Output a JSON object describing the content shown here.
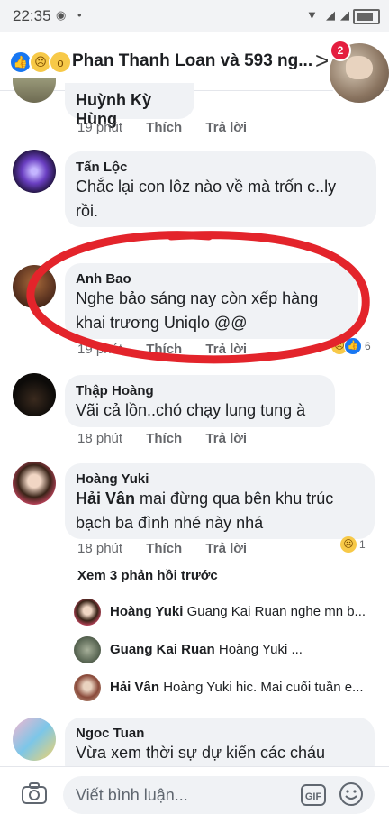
{
  "status_bar": {
    "time": "22:35"
  },
  "header": {
    "title": "Phan Thanh Loan và 593 ng...",
    "chathead_badge": "2"
  },
  "comments": [
    {
      "author": "Huỳnh Kỳ Hùng",
      "text": "",
      "time": "19 phút",
      "like": "Thích",
      "reply": "Trả lời"
    },
    {
      "author": "Tấn Lộc",
      "text1": "Chắc lại con lôz nào về mà trốn c..ly",
      "text2": "rồi."
    },
    {
      "author": "Anh Bao",
      "text1": "Nghe bảo sáng nay còn xếp hàng",
      "text2": "khai trương Uniqlo @@",
      "time": "19 phút",
      "like": "Thích",
      "reply": "Trả lời",
      "reactions": "6"
    },
    {
      "author": "Thập Hoàng",
      "text1": "Vãi cả lồn..chó chạy lung tung à",
      "time": "18 phút",
      "like": "Thích",
      "reply": "Trả lời"
    },
    {
      "author": "Hoàng Yuki",
      "mention": "Hải Vân",
      "text1": " mai đừng qua bên khu trúc",
      "text2": "bạch ba đình nhé này nhá",
      "time": "18 phút",
      "like": "Thích",
      "reply": "Trả lời",
      "reactions": "1"
    },
    {
      "author": "Ngoc Tuan",
      "text1": "Vừa xem thời sự dự kiến các cháu"
    }
  ],
  "replies_link": "Xem 3 phản hồi trước",
  "replies": [
    {
      "name": "Hoàng Yuki",
      "text": "Guang Kai Ruan  nghe mn b..."
    },
    {
      "name": "Guang Kai Ruan",
      "text": "Hoàng Yuki ..."
    },
    {
      "name": "Hải Vân",
      "text": "Hoàng Yuki hic. Mai cuối tuần e..."
    }
  ],
  "composer": {
    "placeholder": "Viết bình luận...",
    "gif": "GIF"
  },
  "colors": {
    "accent": "#1877f2",
    "bubble": "#f0f2f5",
    "annotation": "#e3242b"
  }
}
